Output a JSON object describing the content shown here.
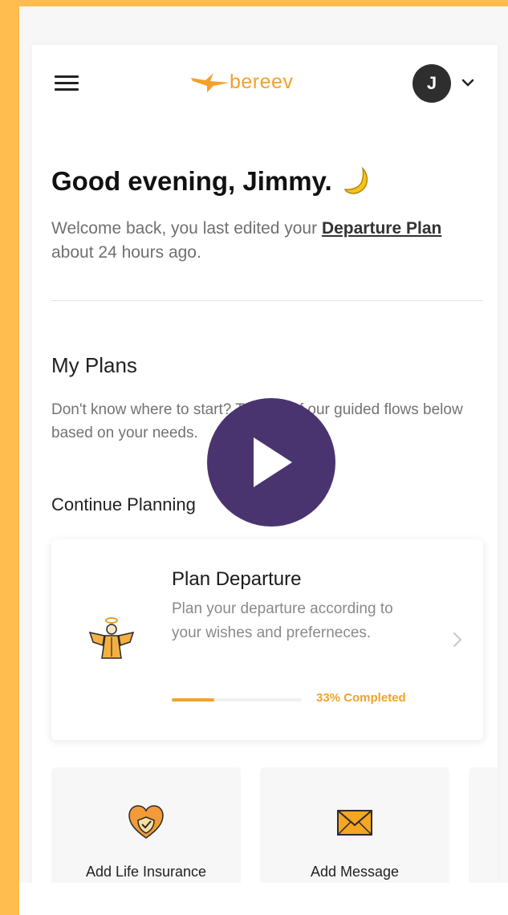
{
  "app": {
    "logo_text": "bereev",
    "avatar_initial": "J"
  },
  "greeting": {
    "title": "Good evening, Jimmy.",
    "welcome_prefix": "Welcome back, you last edited your ",
    "welcome_link": "Departure Plan",
    "welcome_suffix": " about 24 hours ago."
  },
  "plans": {
    "title": "My Plans",
    "description": "Don't know where to start? Try one of our guided flows below based on your needs.",
    "continue_title": "Continue Planning"
  },
  "plan_card": {
    "title": "Plan Departure",
    "description": "Plan your departure according to your wishes and preferneces.",
    "progress": 0.33,
    "progress_label": "33% Completed"
  },
  "tiles": [
    {
      "label": "Add Life Insurance",
      "icon": "heart-shield-icon"
    },
    {
      "label": "Add Message",
      "icon": "envelope-icon"
    }
  ],
  "colors": {
    "accent": "#F2A22A",
    "background": "#FFBC4F",
    "play_button": "#4A3470",
    "avatar": "#2E2E2E"
  }
}
